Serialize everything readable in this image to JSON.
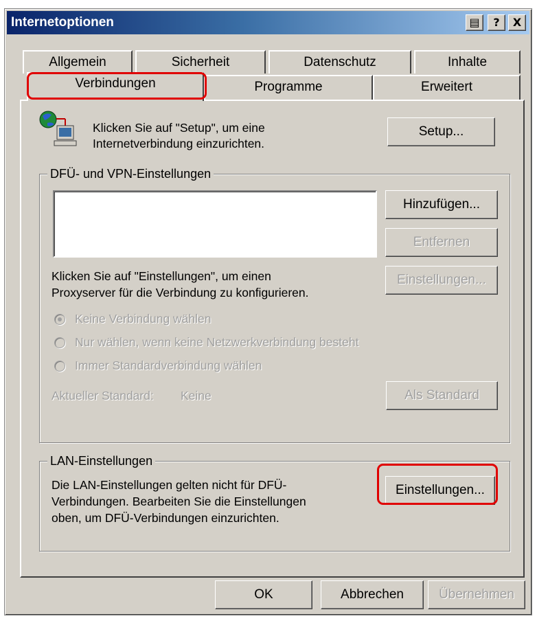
{
  "window": {
    "title": "Internetoptionen",
    "controls": {
      "icon_glyph": "▤",
      "help": "?",
      "close": "X"
    }
  },
  "tabs": {
    "row_back": [
      "Allgemein",
      "Sicherheit",
      "Datenschutz",
      "Inhalte"
    ],
    "row_front": [
      "Verbindungen",
      "Programme",
      "Erweitert"
    ],
    "active": "Verbindungen"
  },
  "setup": {
    "icon": "network-computer-icon",
    "text_line1": "Klicken Sie auf \"Setup\", um eine",
    "text_line2": "Internetverbindung einzurichten.",
    "button": "Setup..."
  },
  "dialup": {
    "legend": "DFÜ- und VPN-Einstellungen",
    "buttons": {
      "add": "Hinzufügen...",
      "remove": "Entfernen",
      "settings": "Einstellungen..."
    },
    "proxy_text_line1": "Klicken Sie auf \"Einstellungen\", um einen",
    "proxy_text_line2": "Proxyserver für die Verbindung zu konfigurieren.",
    "radios": [
      {
        "label": "Keine Verbindung wählen",
        "checked": true
      },
      {
        "label": "Nur wählen, wenn keine Netzwerkverbindung besteht",
        "checked": false
      },
      {
        "label": "Immer Standardverbindung wählen",
        "checked": false
      }
    ],
    "default_label": "Aktueller Standard:",
    "default_value": "Keine",
    "set_default_button": "Als Standard"
  },
  "lan": {
    "legend": "LAN-Einstellungen",
    "text_line1": "Die LAN-Einstellungen gelten nicht für DFÜ-",
    "text_line2": "Verbindungen. Bearbeiten Sie die Einstellungen",
    "text_line3": "oben, um DFÜ-Verbindungen einzurichten.",
    "button": "Einstellungen..."
  },
  "footer": {
    "ok": "OK",
    "cancel": "Abbrechen",
    "apply": "Übernehmen"
  },
  "colors": {
    "highlight": "#e00000",
    "face": "#d4d0c8",
    "title_start": "#0a246a",
    "title_end": "#a6caf0"
  }
}
